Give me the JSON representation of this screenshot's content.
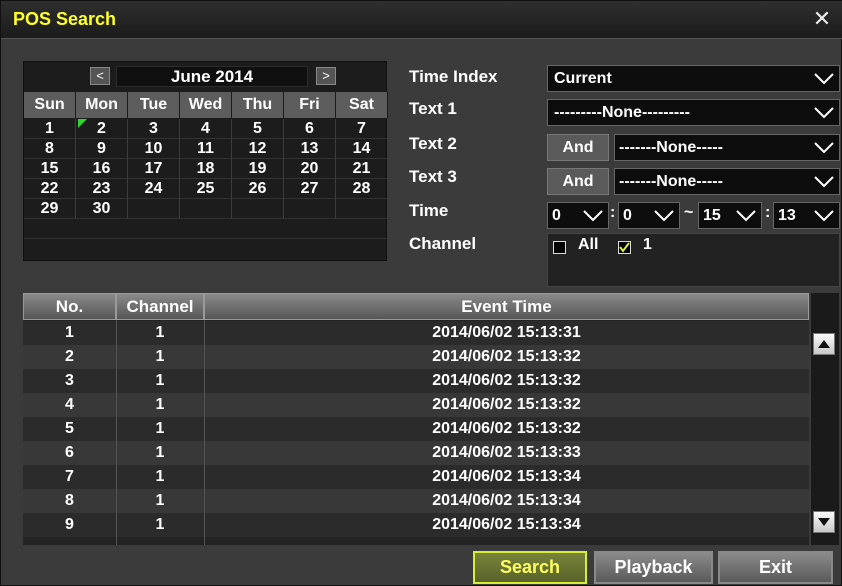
{
  "window": {
    "title": "POS Search",
    "close_icon": "close-icon"
  },
  "calendar": {
    "prev_glyph": "<",
    "next_glyph": ">",
    "month_label": "June 2014",
    "weekdays": [
      "Sun",
      "Mon",
      "Tue",
      "Wed",
      "Thu",
      "Fri",
      "Sat"
    ],
    "weeks": [
      [
        "",
        "",
        "",
        "",
        "",
        "",
        ""
      ],
      [
        "1",
        "2",
        "3",
        "4",
        "5",
        "6",
        "7"
      ],
      [
        "8",
        "9",
        "10",
        "11",
        "12",
        "13",
        "14"
      ],
      [
        "15",
        "16",
        "17",
        "18",
        "19",
        "20",
        "21"
      ],
      [
        "22",
        "23",
        "24",
        "25",
        "26",
        "27",
        "28"
      ],
      [
        "29",
        "30",
        "",
        "",
        "",
        "",
        ""
      ]
    ],
    "marked_day": "2"
  },
  "search": {
    "time_index_label": "Time Index",
    "time_index_value": "Current",
    "text1_label": "Text 1",
    "text1_value": "---------None---------",
    "text2_label": "Text 2",
    "text2_op": "And",
    "text2_value": "-------None-----",
    "text3_label": "Text 3",
    "text3_op": "And",
    "text3_value": "-------None-----",
    "time_label": "Time",
    "time_h1": "0",
    "time_m1": "0",
    "time_sep": ":",
    "time_range_sep": "~",
    "time_h2": "15",
    "time_m2": "13",
    "channel_label": "Channel",
    "channel_all_label": "All",
    "channel_all_checked": false,
    "channel_1_label": "1",
    "channel_1_checked": true
  },
  "table": {
    "columns": [
      "No.",
      "Channel",
      "Event Time"
    ],
    "rows": [
      [
        "1",
        "1",
        "2014/06/02 15:13:31"
      ],
      [
        "2",
        "1",
        "2014/06/02 15:13:32"
      ],
      [
        "3",
        "1",
        "2014/06/02 15:13:32"
      ],
      [
        "4",
        "1",
        "2014/06/02 15:13:32"
      ],
      [
        "5",
        "1",
        "2014/06/02 15:13:32"
      ],
      [
        "6",
        "1",
        "2014/06/02 15:13:33"
      ],
      [
        "7",
        "1",
        "2014/06/02 15:13:34"
      ],
      [
        "8",
        "1",
        "2014/06/02 15:13:34"
      ],
      [
        "9",
        "1",
        "2014/06/02 15:13:34"
      ]
    ]
  },
  "buttons": {
    "search": "Search",
    "playback": "Playback",
    "exit": "Exit"
  },
  "colors": {
    "title": "#ffff2a",
    "accent_marker": "#2fd62f",
    "active_button_border": "#d8ef35"
  }
}
